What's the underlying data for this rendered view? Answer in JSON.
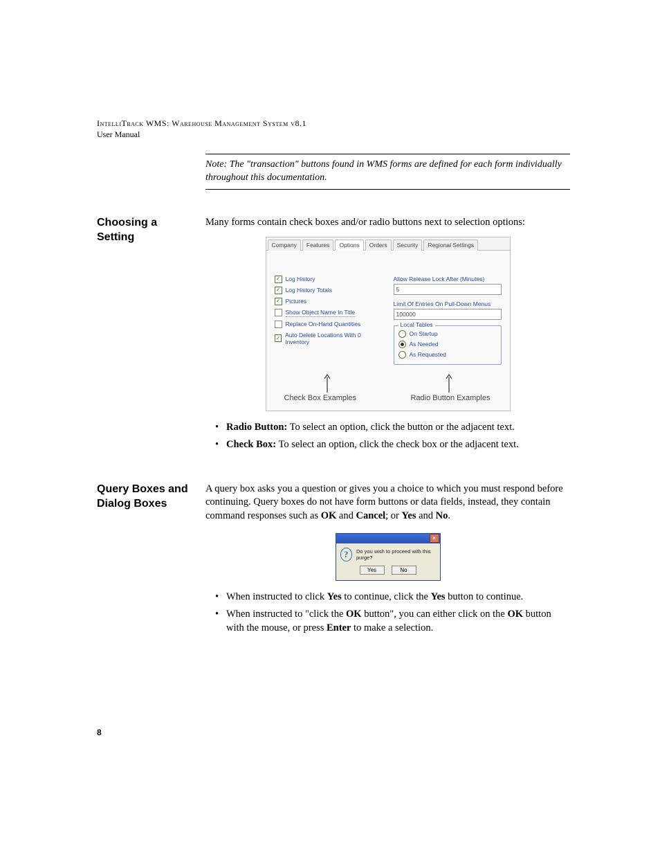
{
  "header": {
    "title": "IntelliTrack WMS: Warehouse Management System v8.1",
    "subtitle": "User Manual"
  },
  "note": {
    "prefix": "Note:",
    "text": "  The \"transaction\" buttons found in WMS forms are defined for each form individually throughout this documentation."
  },
  "section1": {
    "heading": "Choosing a Setting",
    "intro": "Many forms contain check boxes and/or radio buttons next to selection options:",
    "figure": {
      "tabs": [
        "Company",
        "Features",
        "Options",
        "Orders",
        "Security",
        "Regional Settings"
      ],
      "active_tab_index": 2,
      "checkboxes": [
        {
          "label": "Log History",
          "checked": true
        },
        {
          "label": "Log History Totals",
          "checked": true
        },
        {
          "label": "Pictures",
          "checked": true
        },
        {
          "label": "Show Object Name In Title",
          "checked": false,
          "dotted": true
        },
        {
          "label": "Replace On-Hand Quantities",
          "checked": false
        },
        {
          "label": "Auto Delete Locations With 0 Inventory",
          "checked": true
        }
      ],
      "fields": {
        "release_lock_label": "Allow Release Lock After (Minutes)",
        "release_lock_value": "5",
        "pulldown_label": "Limit Of Entries On Pull-Down Menus",
        "pulldown_value": "100000"
      },
      "radio_group": {
        "title": "Local Tables",
        "options": [
          {
            "label": "On Startup",
            "selected": false
          },
          {
            "label": "As Needed",
            "selected": true
          },
          {
            "label": "As Requested",
            "selected": false
          }
        ]
      },
      "caption_left": "Check Box Examples",
      "caption_right": "Radio Button Examples"
    },
    "bullets": [
      {
        "lead": "Radio Button:",
        "text": " To select an option, click the button or the adjacent text."
      },
      {
        "lead": "Check Box:",
        "text": " To select an option, click the check box or the adjacent text."
      }
    ]
  },
  "section2": {
    "heading": "Query Boxes and Dialog Boxes",
    "intro_parts": [
      "A query box asks you a question or gives you a choice to which you must respond before continuing. Query boxes do not have form buttons or data fields, instead, they contain command responses such as ",
      "OK",
      " and ",
      "Cancel",
      "; or ",
      "Yes",
      " and ",
      "No",
      "."
    ],
    "dialog": {
      "message": "Do you wish to proceed with this purge?",
      "yes": "Yes",
      "no": "No",
      "close_glyph": "×",
      "icon_glyph": "?"
    },
    "bullets": [
      {
        "parts": [
          "When instructed to click ",
          "Yes",
          " to continue, click the ",
          "Yes",
          " button to continue."
        ]
      },
      {
        "parts": [
          "When instructed to \"click the ",
          "OK",
          " button\", you can either click on the ",
          "OK",
          " button with the mouse, or press ",
          "Enter",
          " to make a selection."
        ]
      }
    ]
  },
  "page_number": "8"
}
